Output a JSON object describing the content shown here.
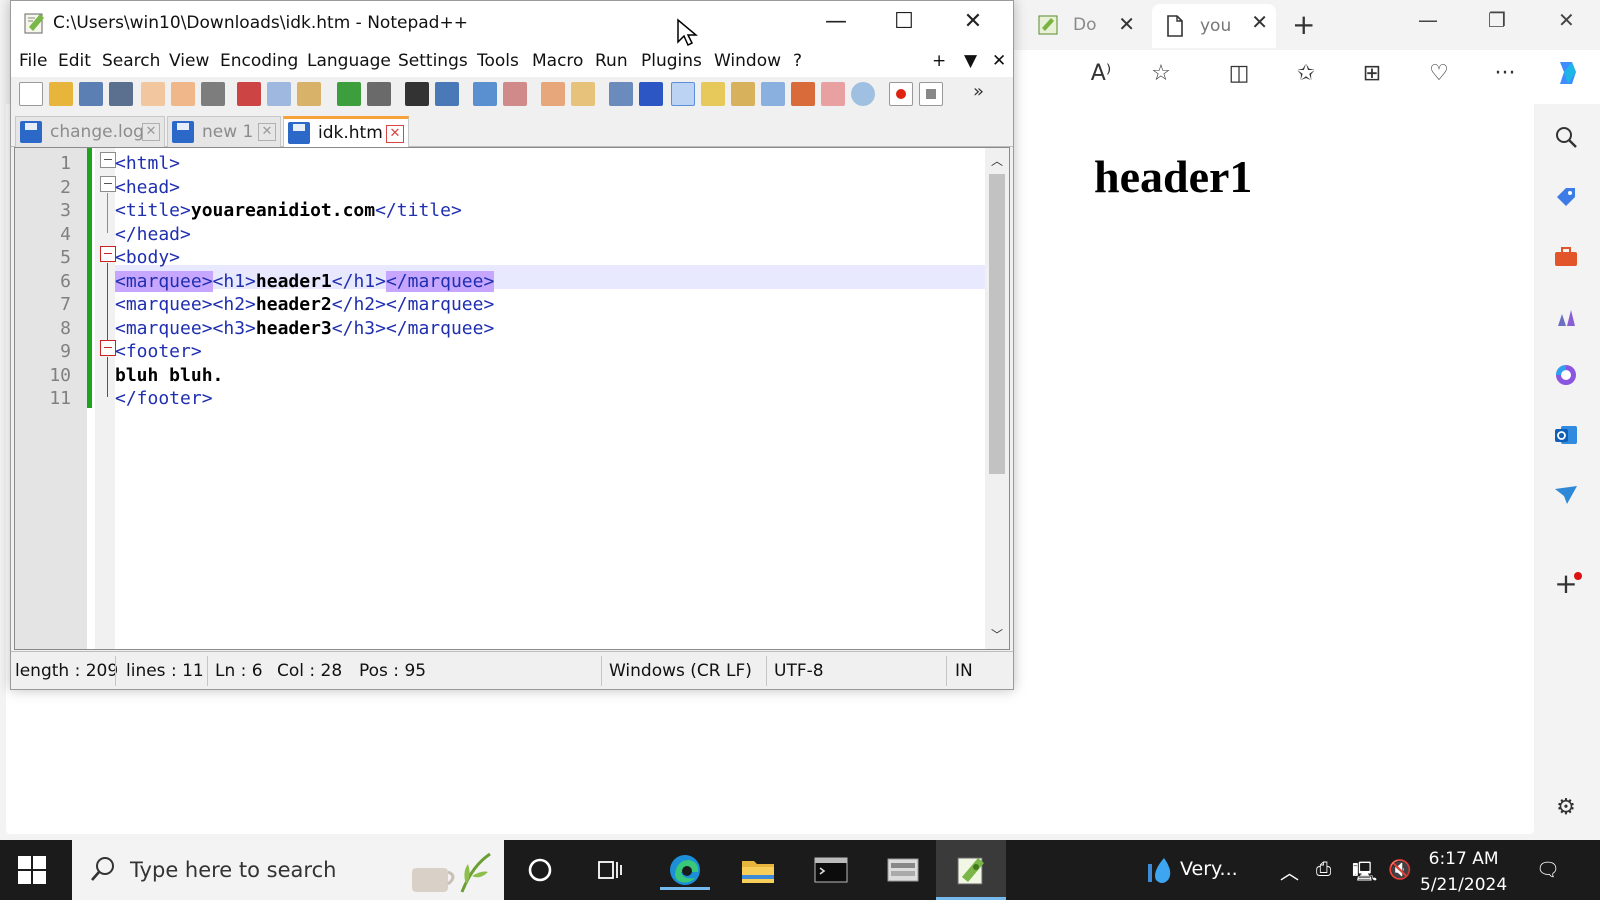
{
  "browser": {
    "tabs": [
      {
        "label": "Do"
      },
      {
        "label": "you"
      }
    ],
    "rendered_heading": "header1"
  },
  "npp": {
    "title": "C:\\Users\\win10\\Downloads\\idk.htm - Notepad++",
    "menu": [
      "File",
      "Edit",
      "Search",
      "View",
      "Encoding",
      "Language",
      "Settings",
      "Tools",
      "Macro",
      "Run",
      "Plugins",
      "Window",
      "?"
    ],
    "menu_right": [
      "+",
      "▼",
      "✕"
    ],
    "doc_tabs": [
      {
        "label": "change.log"
      },
      {
        "label": "new 1"
      },
      {
        "label": "idk.htm"
      }
    ],
    "code_lines": [
      {
        "n": "1",
        "parts": [
          {
            "t": "<html>",
            "c": "tag"
          }
        ]
      },
      {
        "n": "2",
        "parts": [
          {
            "t": "<head>",
            "c": "tag"
          }
        ]
      },
      {
        "n": "3",
        "parts": [
          {
            "t": "<title>",
            "c": "tag"
          },
          {
            "t": "youareanidiot.com",
            "c": "txt"
          },
          {
            "t": "</title>",
            "c": "tag"
          }
        ]
      },
      {
        "n": "4",
        "parts": [
          {
            "t": "</head>",
            "c": "tag"
          }
        ]
      },
      {
        "n": "5",
        "parts": [
          {
            "t": "<body>",
            "c": "tag"
          }
        ]
      },
      {
        "n": "6",
        "parts": [
          {
            "t": "<marquee>",
            "c": "tag hl"
          },
          {
            "t": "<h1>",
            "c": "tag"
          },
          {
            "t": "header1",
            "c": "txt"
          },
          {
            "t": "</h1>",
            "c": "tag"
          },
          {
            "t": "</marquee>",
            "c": "tag hl"
          }
        ]
      },
      {
        "n": "7",
        "parts": [
          {
            "t": "<marquee>",
            "c": "tag"
          },
          {
            "t": "<h2>",
            "c": "tag"
          },
          {
            "t": "header2",
            "c": "txt"
          },
          {
            "t": "</h2>",
            "c": "tag"
          },
          {
            "t": "</marquee>",
            "c": "tag"
          }
        ]
      },
      {
        "n": "8",
        "parts": [
          {
            "t": "<marquee>",
            "c": "tag"
          },
          {
            "t": "<h3>",
            "c": "tag"
          },
          {
            "t": "header3",
            "c": "txt"
          },
          {
            "t": "</h3>",
            "c": "tag"
          },
          {
            "t": "</marquee>",
            "c": "tag"
          }
        ]
      },
      {
        "n": "9",
        "parts": [
          {
            "t": "<footer>",
            "c": "tag"
          }
        ]
      },
      {
        "n": "10",
        "parts": [
          {
            "t": "bluh bluh.",
            "c": "txt"
          }
        ]
      },
      {
        "n": "11",
        "parts": [
          {
            "t": "</footer>",
            "c": "tag"
          }
        ]
      }
    ],
    "status": {
      "length": "length : 209",
      "lines": "lines : 11",
      "ln": "Ln : 6",
      "col": "Col : 28",
      "pos": "Pos : 95",
      "eol": "Windows (CR LF)",
      "encoding": "UTF-8",
      "mode": "IN"
    }
  },
  "taskbar": {
    "search_placeholder": "Type here to search",
    "weather": "Very...",
    "time": "6:17 AM",
    "date": "5/21/2024"
  },
  "colors": {
    "tag": "#1f2fb0",
    "highlight": "#c6a6ff",
    "active_tab_accent": "#f7a13a",
    "change_bar": "#1da31d",
    "taskbar": "#1b1b1b"
  }
}
